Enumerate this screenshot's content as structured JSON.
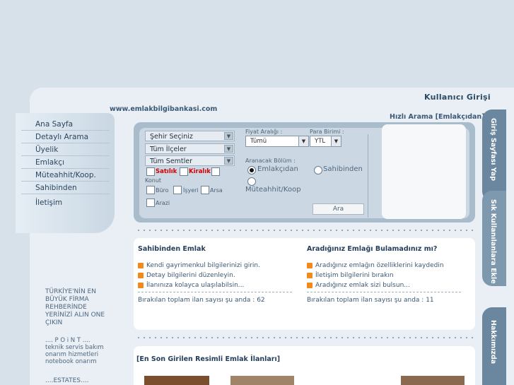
{
  "header": {
    "user_login": "Kullanıcı Girişi",
    "site_url": "www.emlakbilgibankasi.com",
    "quick_search_title": "Hızlı Arama [Emlakçıdan]"
  },
  "nav": {
    "items": [
      "Ana Sayfa",
      "Detaylı Arama",
      "Üyelik",
      "Emlakçı",
      "Müteahhit/Koop.",
      "Sahibinden",
      "İletişim"
    ]
  },
  "search": {
    "city_select": "Şehir Seçiniz",
    "district_select": "Tüm İlçeler",
    "neighborhood_select": "Tüm Semtler",
    "satilik": "Satılık",
    "kiralik": "Kiralık",
    "konut": "Konut",
    "buro": "Büro",
    "isyeri": "İşyeri",
    "arsa": "Arsa",
    "arazi": "Arazi",
    "price_range_label": "Fiyat Aralığı :",
    "price_range_value": "Tümü",
    "currency_label": "Para Birimi :",
    "currency_value": "YTL",
    "section_label": "Aranacak Bölüm :",
    "opt_emlakcidan": "Emlakçıdan",
    "opt_sahibinden": "Sahibinden",
    "opt_muteahhit": "Müteahhit/Koop",
    "search_button": "Ara"
  },
  "sahibinden": {
    "title": "Sahibinden Emlak",
    "items": [
      "Kendi gayrimenkul bilgilerinizi girin.",
      "Detay bilgilerini düzenleyin.",
      "İlanınıza kolayca ulaşılabilsin..."
    ],
    "count_text": "Bırakılan toplam ilan sayısı şu anda : 62"
  },
  "aradiginiz": {
    "title": "Aradığınız Emlağı Bulamadınız mı?",
    "items": [
      "Aradığınız emlağın özelliklerini kaydedin",
      "İletişim bilgilerini bırakın",
      "Aradığınız emlak sizi bulsun..."
    ],
    "count_text": "Bırakılan toplam ilan sayısı şu anda : 11"
  },
  "latest": {
    "title": "[En Son Girilen Resimli Emlak İlanları]"
  },
  "sidetabs": {
    "home": "Giriş Sayfası Yap",
    "favorites": "Sık Kullanılanlara Ekle",
    "about": "Hakkımızda"
  },
  "left_notes": {
    "promo": [
      "TÜRKİYE'NİN EN",
      "BÜYÜK FİRMA",
      "REHBERİNDE",
      "YERİNİZİ ALIN ONE",
      "ÇIKIN"
    ],
    "point_title": ".... P O i N T ....",
    "point_lines": [
      "teknik servis bakım",
      "onarım hizmetleri",
      "notebook onarım"
    ],
    "estates": "....ESTATES...."
  }
}
